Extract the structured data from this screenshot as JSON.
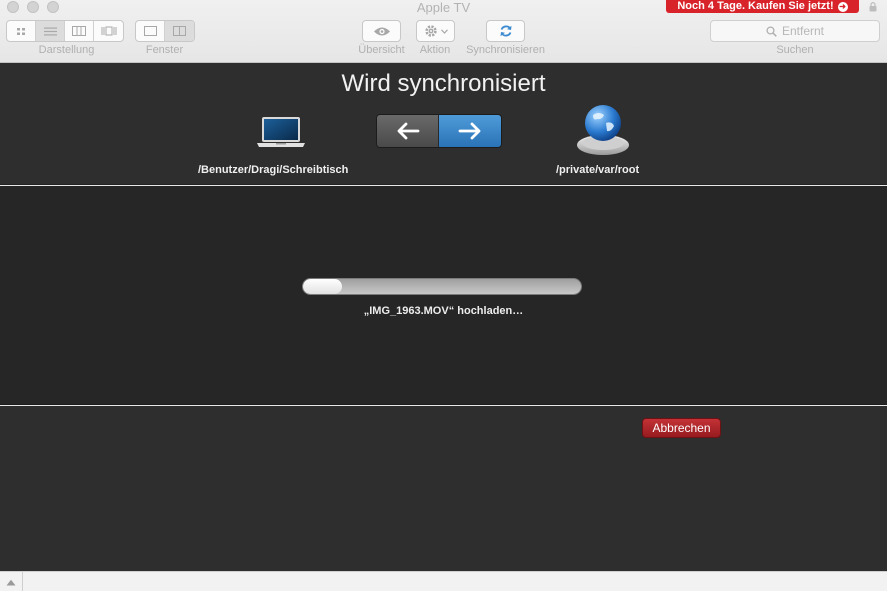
{
  "window": {
    "title": "Apple TV",
    "promo_label": "Noch 4 Tage. Kaufen Sie jetzt!"
  },
  "toolbar": {
    "view_label": "Darstellung",
    "window_label": "Fenster",
    "overview_label": "Übersicht",
    "action_label": "Aktion",
    "sync_label": "Synchronisieren",
    "search_placeholder": "Entfernt",
    "search_label": "Suchen"
  },
  "sync": {
    "title": "Wird synchronisiert",
    "local_path": "/Benutzer/Dragi/Schreibtisch",
    "remote_path": "/private/var/root",
    "direction": "right"
  },
  "progress": {
    "fraction": 0.14,
    "status_text": "„IMG_1963.MOV“ hochladen…"
  },
  "actions": {
    "cancel_label": "Abbrechen"
  },
  "colors": {
    "promo": "#d8232a",
    "cancel": "#b5262b",
    "accent": "#3c8bd0"
  }
}
